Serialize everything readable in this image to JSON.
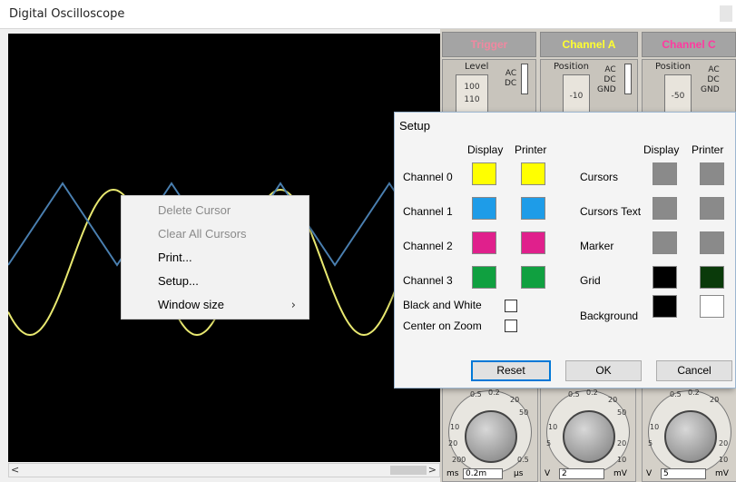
{
  "window": {
    "title": "Digital Oscilloscope"
  },
  "panel": {
    "headers": [
      {
        "label": "Trigger",
        "color": "#f088a0"
      },
      {
        "label": "Channel A",
        "color": "#ffff30"
      },
      {
        "label": "Channel C",
        "color": "#ff3aa0"
      }
    ],
    "trigger": {
      "label": "Level",
      "value": "100",
      "value2": "110",
      "coupling": [
        "AC",
        "DC"
      ]
    },
    "channel_a": {
      "label": "Position",
      "value": "-10",
      "coupling": [
        "AC",
        "DC",
        "GND"
      ]
    },
    "channel_c": {
      "label": "Position",
      "value": "-50",
      "coupling": [
        "AC",
        "DC",
        "GND"
      ]
    },
    "knobs": [
      {
        "value": "0.2m",
        "unit_left": "ms",
        "unit_right": "µs",
        "ticks": [
          "0.5",
          "0.2",
          "20",
          "50",
          "10",
          "20",
          "200",
          "0.5"
        ]
      },
      {
        "value": "2",
        "unit_left": "V",
        "unit_right": "mV",
        "ticks": [
          "0.5",
          "0.2",
          "20",
          "50",
          "10",
          "5",
          "20",
          "10"
        ]
      },
      {
        "value": "5",
        "unit_left": "V",
        "unit_right": "mV",
        "ticks": [
          "0.5",
          "0.2",
          "20",
          "10",
          "5",
          "20",
          "10"
        ]
      }
    ]
  },
  "context_menu": {
    "items": [
      {
        "label": "Delete Cursor",
        "disabled": true
      },
      {
        "label": "Clear All Cursors",
        "disabled": true
      },
      {
        "label": "Print...",
        "disabled": false
      },
      {
        "label": "Setup...",
        "disabled": false
      },
      {
        "label": "Window size",
        "disabled": false,
        "submenu": true
      }
    ],
    "submenu_arrow": "›"
  },
  "setup": {
    "title": "Setup",
    "col_display": "Display",
    "col_printer": "Printer",
    "left_rows": [
      {
        "label": "Channel 0",
        "display": "#ffff00",
        "printer": "#ffff00"
      },
      {
        "label": "Channel 1",
        "display": "#1e9ce8",
        "printer": "#1e9ce8"
      },
      {
        "label": "Channel 2",
        "display": "#e0208c",
        "printer": "#e0208c"
      },
      {
        "label": "Channel 3",
        "display": "#10a040",
        "printer": "#10a040"
      }
    ],
    "right_rows": [
      {
        "label": "Cursors",
        "display": "#8a8a8a",
        "printer": "#8a8a8a"
      },
      {
        "label": "Cursors Text",
        "display": "#8a8a8a",
        "printer": "#8a8a8a"
      },
      {
        "label": "Marker",
        "display": "#8a8a8a",
        "printer": "#8a8a8a"
      },
      {
        "label": "Grid",
        "display": "#000000",
        "printer": "#0a3a0a"
      },
      {
        "label": "Background",
        "display": "#000000",
        "printer": "#ffffff"
      }
    ],
    "checkboxes": [
      {
        "label": "Black and White",
        "checked": false
      },
      {
        "label": "Center on Zoom",
        "checked": false
      }
    ],
    "buttons": {
      "reset": "Reset",
      "ok": "OK",
      "cancel": "Cancel"
    }
  },
  "scope": {
    "trace_yellow": "#e8e870",
    "trace_blue": "#4a7fb0",
    "background": "#000000"
  }
}
